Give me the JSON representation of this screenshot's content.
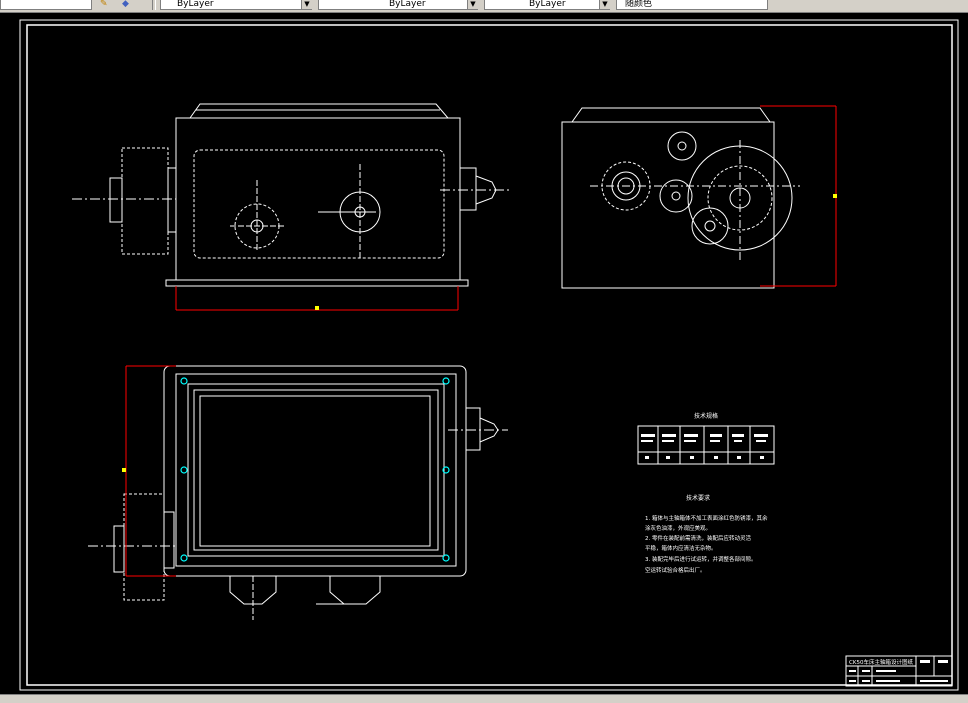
{
  "toolbar": {
    "layer_combo": "ByLayer",
    "linetype_combo": "ByLayer",
    "lineweight_combo": "ByLayer",
    "color_combo": "随颜色"
  },
  "drawing": {
    "title_block_text": "CK50车床主轴箱设计图纸",
    "table_title": "技术规格",
    "notes_title": "技术要求",
    "notes": [
      "1. 箱体与主轴箱体不加工表面涂红色防锈漆，其余",
      "   涂灰色油漆，外观应美观。",
      "2. 零件在装配前需清洗，装配后应转动灵活",
      "   平稳，箱体内应清洁无杂物。",
      "3. 装配完毕后进行试运转，并调整各部间隙。",
      "   空运转试验合格后出厂。"
    ],
    "colors": {
      "line": "#ffffff",
      "dim": "#ff0000",
      "accent": "#ffff00",
      "cyan": "#00ffff"
    }
  }
}
